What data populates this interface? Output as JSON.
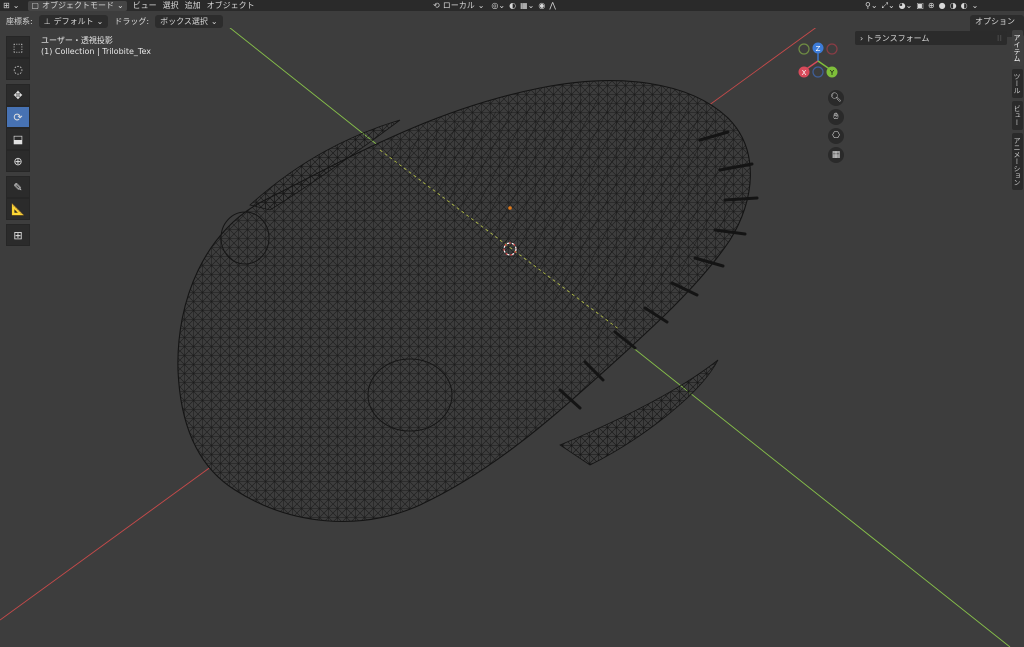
{
  "header": {
    "mode": "オブジェクトモード",
    "menus": [
      "ビュー",
      "選択",
      "追加",
      "オブジェクト"
    ],
    "transform_orientation": "ローカル"
  },
  "toolbar2": {
    "coord_label": "座標系:",
    "coord_value": "デフォルト",
    "drag_label": "ドラッグ:",
    "drag_value": "ボックス選択",
    "options": "オプション"
  },
  "viewport": {
    "view_name": "ユーザー・透視投影",
    "collection_info": "(1) Collection | Trilobite_Tex"
  },
  "gizmo": {
    "z": "Z",
    "x": "X",
    "y": "Y"
  },
  "npanel": {
    "transform": "トランスフォーム"
  },
  "side_tabs": [
    "アイテム",
    "ツール",
    "ビュー",
    "アニメーション"
  ],
  "colors": {
    "x_axis": "#c84a4a",
    "y_axis": "#88c24a",
    "active_tool": "#4772b3",
    "background": "#3d3d3d"
  }
}
